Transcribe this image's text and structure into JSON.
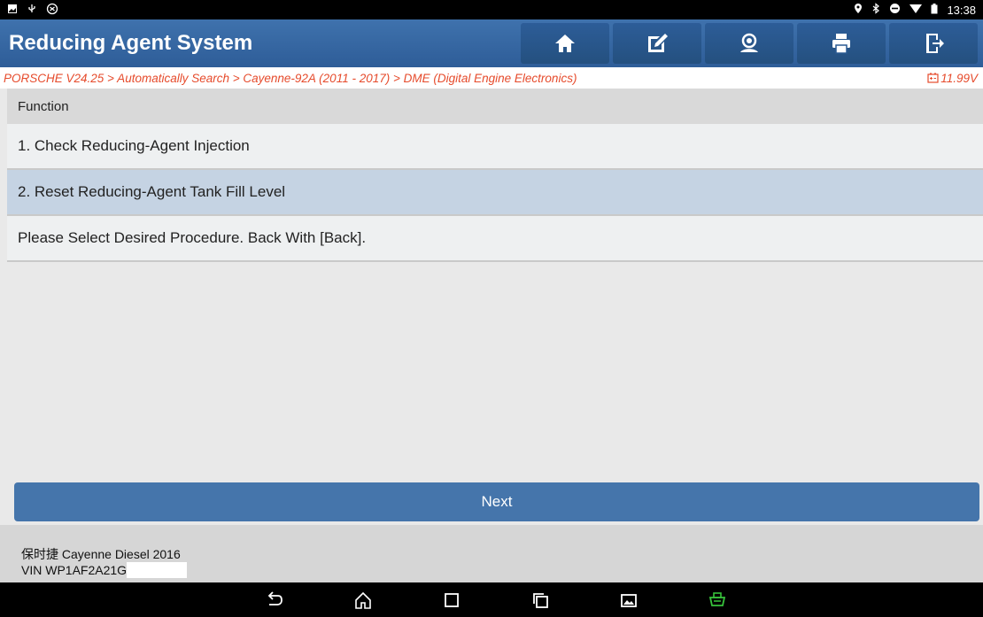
{
  "statusbar": {
    "time": "13:38"
  },
  "appbar": {
    "title": "Reducing Agent System",
    "icons": [
      "home-icon",
      "edit-icon",
      "user-icon",
      "print-icon",
      "exit-icon"
    ]
  },
  "breadcrumb": {
    "path": "PORSCHE V24.25 > Automatically Search > Cayenne-92A (2011 - 2017) > DME (Digital Engine Electronics)",
    "voltage": "11.99V"
  },
  "table": {
    "header": "Function",
    "rows": [
      "1. Check Reducing-Agent Injection",
      "2. Reset Reducing-Agent Tank Fill Level"
    ],
    "selected_index": 1,
    "message": "Please Select Desired Procedure.  Back With [Back]."
  },
  "next_label": "Next",
  "footer": {
    "vehicle": "保时捷 Cayenne Diesel 2016",
    "vin": "VIN WP1AF2A21G"
  },
  "colors": {
    "appbar": "#3f72ad",
    "crumb_text": "#e64b2c",
    "selected_row": "#c5d3e3",
    "next": "#4575ab"
  }
}
